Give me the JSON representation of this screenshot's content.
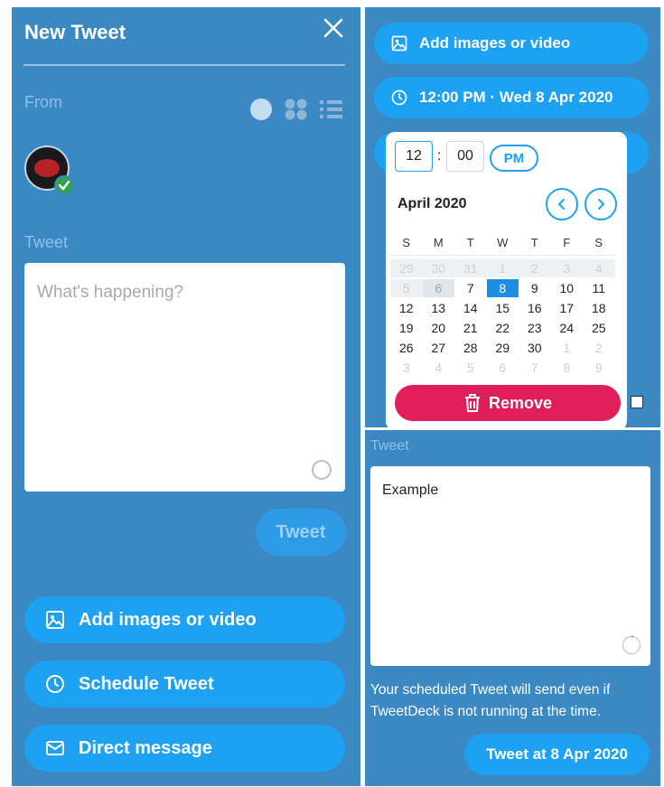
{
  "left": {
    "title": "New Tweet",
    "from_label": "From",
    "tweet_label": "Tweet",
    "placeholder": "What's happening?",
    "tweet_button": "Tweet",
    "actions": [
      {
        "icon": "image-icon",
        "label": "Add images or video"
      },
      {
        "icon": "clock-icon",
        "label": "Schedule Tweet"
      },
      {
        "icon": "envelope-icon",
        "label": "Direct message"
      }
    ]
  },
  "right_top": {
    "add_media": "Add images or video",
    "schedule_value": "12:00 PM · Wed 8 Apr 2020",
    "picker": {
      "hour": "12",
      "separator": ":",
      "minute": "00",
      "ampm": "PM",
      "month": "April 2020",
      "weekdays": [
        "S",
        "M",
        "T",
        "W",
        "T",
        "F",
        "S"
      ],
      "weeks": [
        [
          "29",
          "30",
          "31",
          "1",
          "2",
          "3",
          "4"
        ],
        [
          "5",
          "6",
          "7",
          "8",
          "9",
          "10",
          "11"
        ],
        [
          "12",
          "13",
          "14",
          "15",
          "16",
          "17",
          "18"
        ],
        [
          "19",
          "20",
          "21",
          "22",
          "23",
          "24",
          "25"
        ],
        [
          "26",
          "27",
          "28",
          "29",
          "30",
          "1",
          "2"
        ],
        [
          "3",
          "4",
          "5",
          "6",
          "7",
          "8",
          "9"
        ]
      ],
      "selected_day": "8",
      "remove_label": "Remove"
    }
  },
  "right_bottom": {
    "tweet_label": "Tweet",
    "tweet_text": "Example",
    "notice": "Your scheduled Tweet will send even if TweetDeck is not running at the time.",
    "submit_label": "Tweet at 8 Apr 2020"
  },
  "colors": {
    "panel": "#3b88c3",
    "button": "#1da1f2",
    "remove": "#e01f5a",
    "selected": "#1d8fe0"
  }
}
